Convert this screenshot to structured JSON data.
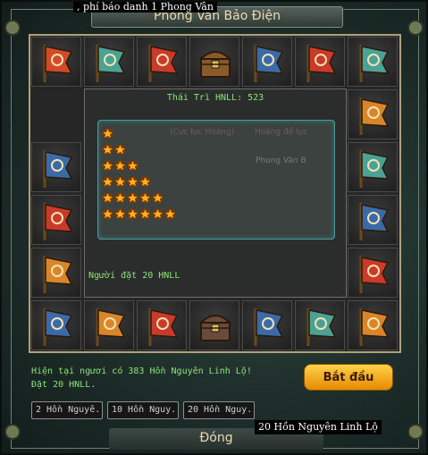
{
  "window": {
    "title": "Phong Vân Bảo Điện",
    "tooltip_top": ", phí báo danh 1 Phong Vân"
  },
  "center": {
    "title": "Thái Trì HNLL: 523",
    "faded_left": "(Cực lục Hoàng)",
    "faded_right": "Hoàng đế lục",
    "faded_third": "Phong Vân B",
    "star_rows": [
      1,
      2,
      3,
      4,
      5,
      6
    ],
    "bet_label": "Người đặt 20 HNLL"
  },
  "status": {
    "line1": "Hiện tại ngươi có 383 Hồn Nguyên Linh Lộ!",
    "line2": "Đặt 20 HNLL."
  },
  "buttons": {
    "start": "Bắt đầu",
    "close": "Đóng",
    "options": [
      "2 Hồn Nguyê.",
      "10 Hồn Nguy.",
      "20 Hồn Nguy."
    ]
  },
  "tooltip_bottom": "20 Hồn Nguyên Linh Lộ",
  "board_cells": [
    {
      "icon": "red-dragon-flag-icon",
      "color": "#d34a2a"
    },
    {
      "icon": "teal-flags-icon",
      "color": "#4aa294"
    },
    {
      "icon": "red-c-flag-icon",
      "color": "#c93a2a"
    },
    {
      "icon": "treasure-chest-icon",
      "color": "#8a5a2a"
    },
    {
      "icon": "blue-flag-icon",
      "color": "#3a6aa8"
    },
    {
      "icon": "red-c-flags-icon",
      "color": "#c93a2a"
    },
    {
      "icon": "teal-flag-icon",
      "color": "#4aa294"
    },
    {
      "icon": "orange-flag-icon",
      "color": "#d9862a"
    },
    {
      "icon": "teal-flag-icon",
      "color": "#4aa294"
    },
    {
      "icon": "blue-flag-icon",
      "color": "#3a6aa8"
    },
    {
      "icon": "red-c-flag-icon",
      "color": "#c93a2a"
    },
    {
      "icon": "orange-flags-icon",
      "color": "#d9862a"
    },
    {
      "icon": "teal-flags-icon",
      "color": "#4aa294"
    },
    {
      "icon": "blue-flags-icon",
      "color": "#3a6aa8"
    },
    {
      "icon": "treasure-chest-icon",
      "color": "#6a4a3a"
    },
    {
      "icon": "red-c-flag-icon",
      "color": "#c93a2a"
    },
    {
      "icon": "orange-flags-icon",
      "color": "#d9862a"
    },
    {
      "icon": "blue-flag-icon",
      "color": "#3a6aa8"
    },
    {
      "icon": "orange-dragon-flag-icon",
      "color": "#d9862a"
    },
    {
      "icon": "red-c-flag-icon",
      "color": "#c93a2a"
    },
    {
      "icon": "blue-flags-icon",
      "color": "#3a6aa8"
    }
  ],
  "colors": {
    "accent_green": "#8ee27a",
    "button_gold": "#ffb020",
    "border_gold": "#b2a07a"
  }
}
